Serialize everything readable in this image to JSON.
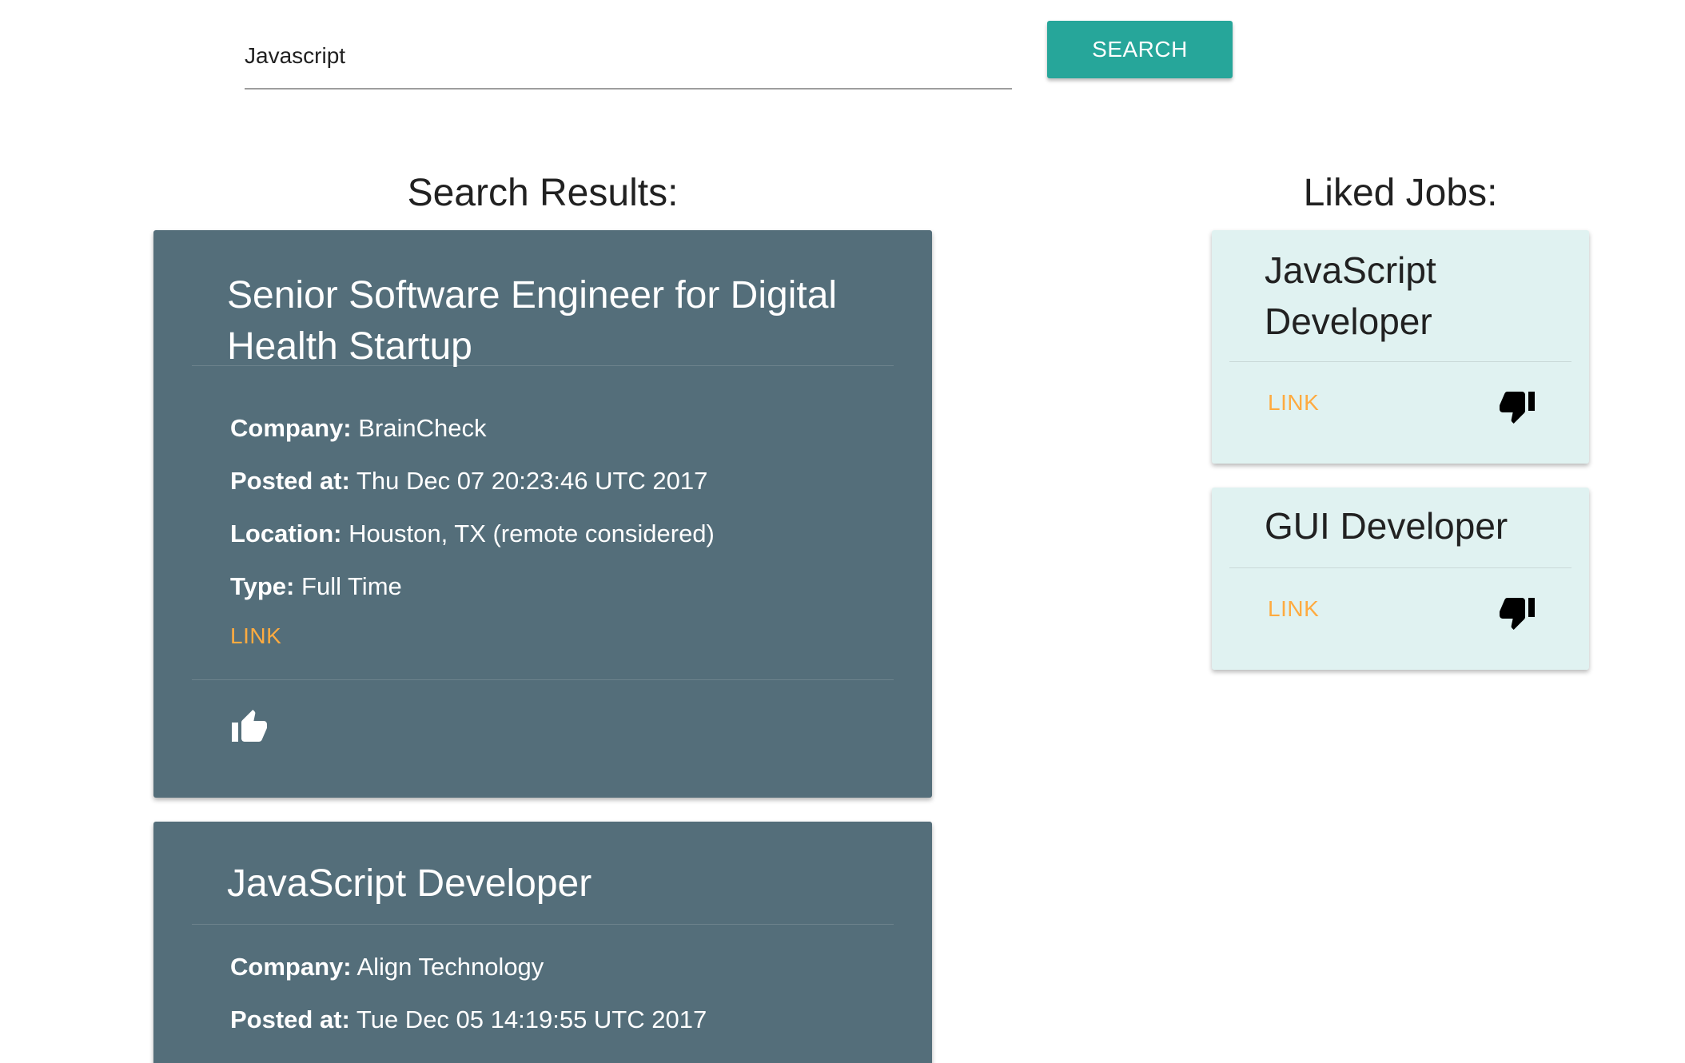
{
  "search": {
    "value": "Javascript",
    "button_label": "SEARCH"
  },
  "results_heading": "Search Results:",
  "liked_heading": "Liked Jobs:",
  "results": [
    {
      "title": "Senior Software Engineer for Digital Health Startup",
      "company_label": "Company:",
      "company": "BrainCheck",
      "posted_label": "Posted at:",
      "posted": "Thu Dec 07 20:23:46 UTC 2017",
      "location_label": "Location:",
      "location": "Houston, TX (remote considered)",
      "type_label": "Type:",
      "type": "Full Time",
      "link_label": "LINK",
      "action_icon": "thumb-up-icon"
    },
    {
      "title": "JavaScript Developer",
      "company_label": "Company:",
      "company": "Align Technology",
      "posted_label": "Posted at:",
      "posted": "Tue Dec 05 14:19:55 UTC 2017"
    }
  ],
  "liked": [
    {
      "title": "JavaScript Developer",
      "link_label": "LINK",
      "action_icon": "thumb-down-icon"
    },
    {
      "title": "GUI Developer",
      "link_label": "LINK",
      "action_icon": "thumb-down-icon"
    }
  ],
  "colors": {
    "accent": "#26a69a",
    "result_card": "#546e7a",
    "liked_card": "#e0f2f1",
    "link": "#ffab40"
  }
}
